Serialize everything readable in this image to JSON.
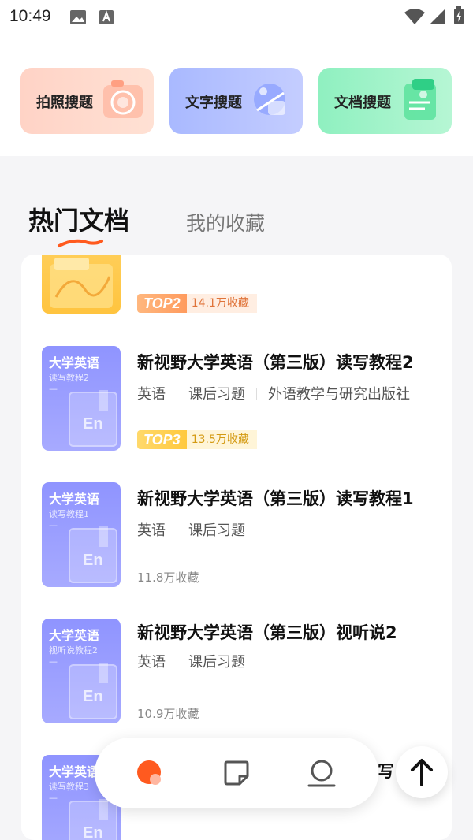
{
  "status_bar": {
    "time": "10:49"
  },
  "search": {
    "photo_label": "拍照搜题",
    "text_label": "文字搜题",
    "doc_label": "文档搜题"
  },
  "tabs": {
    "hot": "热门文档",
    "favorites": "我的收藏"
  },
  "items": [
    {
      "rank": "TOP2",
      "favorites": "14.1万收藏"
    },
    {
      "cover_title": "大学英语",
      "cover_sub": "读写教程2",
      "cover_dash": "—",
      "cover_en": "En",
      "title": "新视野大学英语（第三版）读写教程2",
      "tags": [
        "英语",
        "课后习题",
        "外语教学与研究出版社"
      ],
      "rank": "TOP3",
      "favorites": "13.5万收藏"
    },
    {
      "cover_title": "大学英语",
      "cover_sub": "读写教程1",
      "cover_dash": "—",
      "cover_en": "En",
      "title": "新视野大学英语（第三版）读写教程1",
      "tags": [
        "英语",
        "课后习题"
      ],
      "favorites": "11.8万收藏"
    },
    {
      "cover_title": "大学英语",
      "cover_sub": "视听说教程2",
      "cover_dash": "—",
      "cover_en": "En",
      "title": "新视野大学英语（第三版）视听说2",
      "tags": [
        "英语",
        "课后习题"
      ],
      "favorites": "10.9万收藏"
    },
    {
      "cover_title": "大学英语",
      "cover_sub": "读写教程3",
      "cover_dash": "—",
      "cover_en": "En",
      "title_partial": "写"
    }
  ],
  "colors": {
    "accent": "#ff5a1f",
    "cover": "#9a9dff"
  }
}
